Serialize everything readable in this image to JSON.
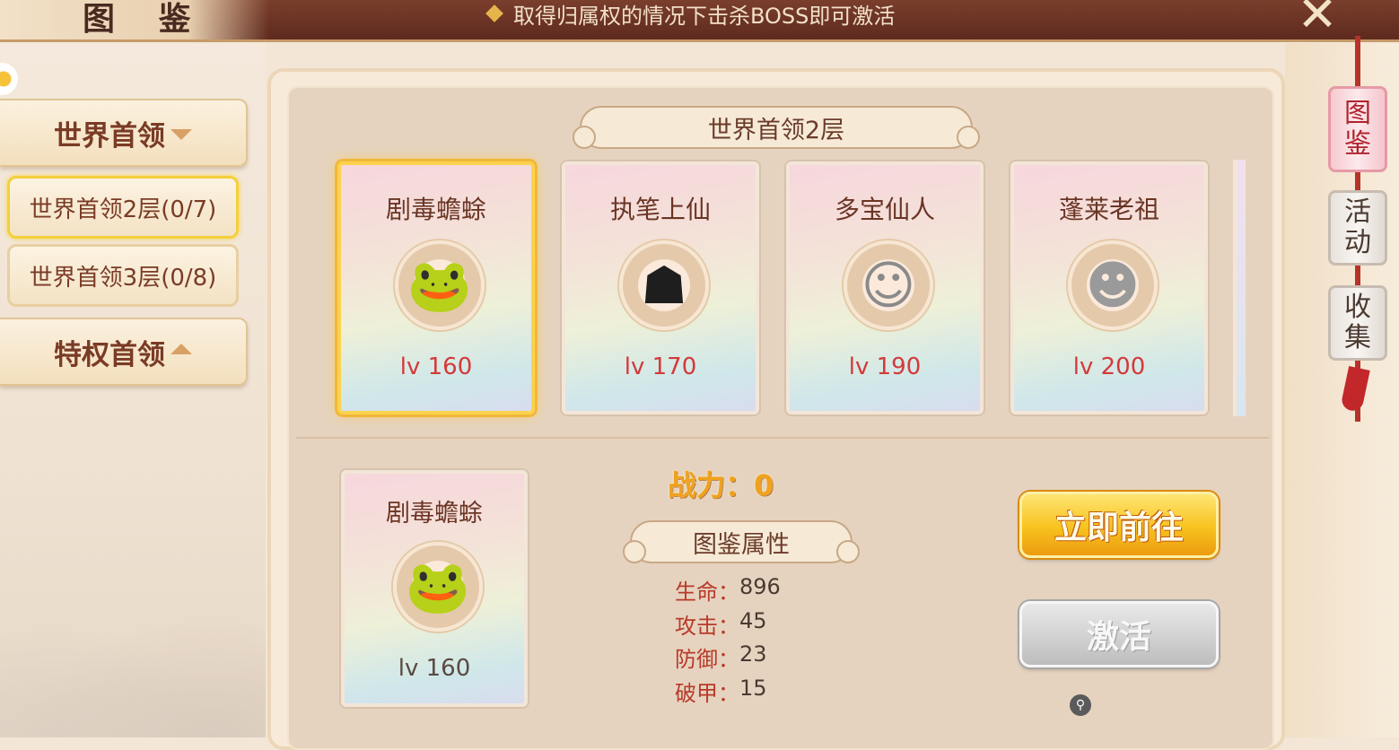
{
  "header": {
    "title": "图 鉴",
    "hint": "取得归属权的情况下击杀BOSS即可激活",
    "close_label": "✕"
  },
  "sidebar": {
    "categories": [
      {
        "label": "世界首领",
        "state": "expanded"
      },
      {
        "label": "特权首领",
        "state": "collapsed"
      }
    ],
    "subitems": [
      {
        "label": "世界首领2层(0/7)",
        "active": true
      },
      {
        "label": "世界首领3层(0/8)",
        "active": false
      }
    ]
  },
  "section_title": "世界首领2层",
  "bosses": [
    {
      "name": "剧毒蟾蜍",
      "level": "lv 160",
      "selected": true,
      "icon": "toad-portrait-icon"
    },
    {
      "name": "执笔上仙",
      "level": "lv 170",
      "selected": false,
      "icon": "demon-portrait-icon"
    },
    {
      "name": "多宝仙人",
      "level": "lv 190",
      "selected": false,
      "icon": "immortal-portrait-icon"
    },
    {
      "name": "蓬莱老祖",
      "level": "lv 200",
      "selected": false,
      "icon": "elder-portrait-icon"
    }
  ],
  "detail": {
    "name": "剧毒蟾蜍",
    "level": "lv 160",
    "power": "战力：0",
    "attr_title": "图鉴属性",
    "attributes": [
      {
        "key": "生命：",
        "value": "896"
      },
      {
        "key": "攻击：",
        "value": "45"
      },
      {
        "key": "防御：",
        "value": "23"
      },
      {
        "key": "破甲：",
        "value": "15"
      }
    ]
  },
  "actions": {
    "goto_label": "立即前往",
    "activate_label": "激活"
  },
  "side_tabs": [
    {
      "label1": "图",
      "label2": "鉴",
      "active": true
    },
    {
      "label1": "活",
      "label2": "动",
      "active": false
    },
    {
      "label1": "收",
      "label2": "集",
      "active": false
    }
  ],
  "colors": {
    "accent_gold": "#f7c21e",
    "level_red": "#d23a3a",
    "brown_text": "#6a3524"
  }
}
